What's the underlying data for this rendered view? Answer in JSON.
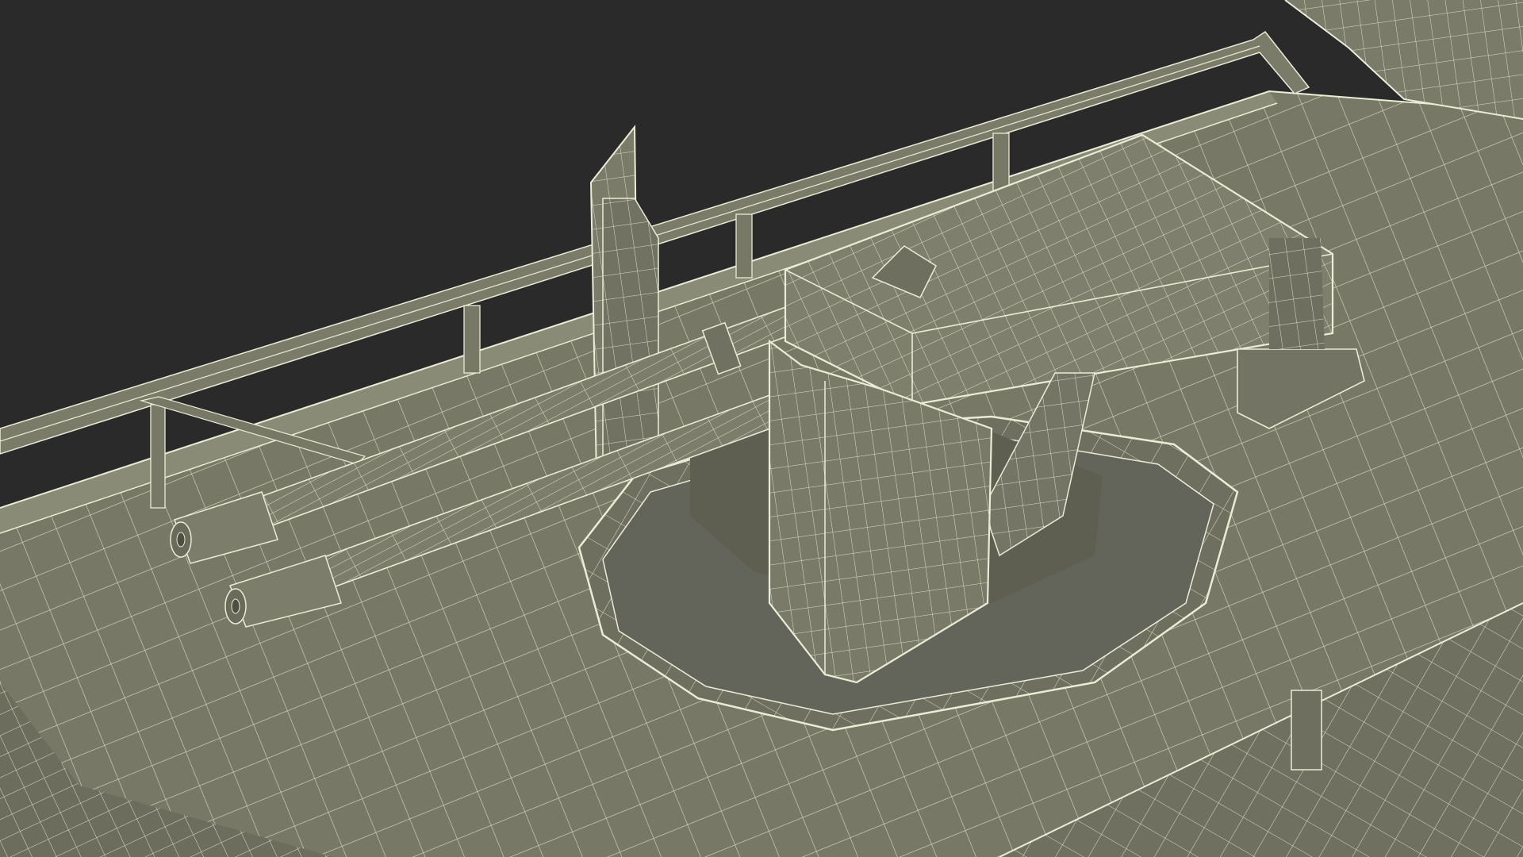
{
  "render": {
    "background_color": "#2a2a2a",
    "surface_color": "#777866",
    "surface_shadow_color": "#5e5f50",
    "surface_light_color": "#8a8b77",
    "wire_color": "#e9ecd6"
  }
}
